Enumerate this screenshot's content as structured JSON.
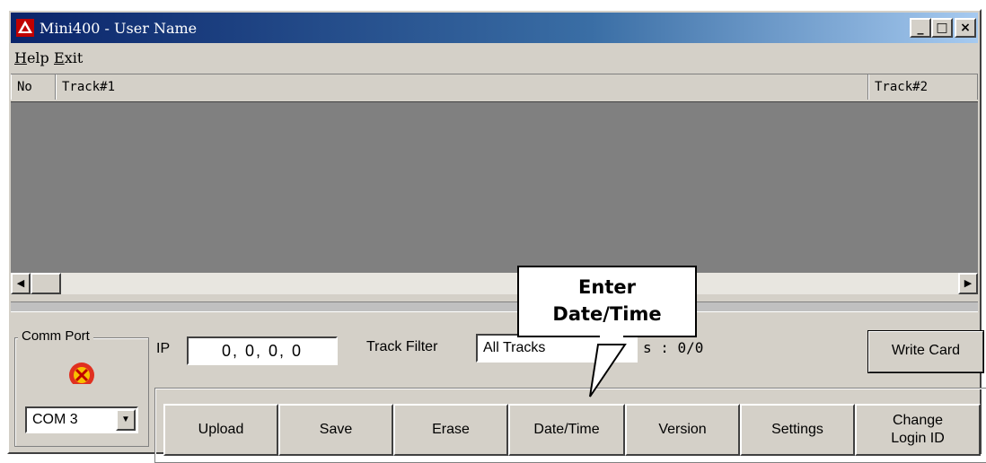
{
  "window": {
    "title": "Mini400  -  User Name",
    "controls": {
      "minimize": "_",
      "maximize": "□",
      "close": "×"
    }
  },
  "menu": [
    {
      "label": "elp",
      "mnemonic": "H"
    },
    {
      "label": "xit",
      "mnemonic": "E"
    }
  ],
  "grid": {
    "columns": [
      "No",
      "Track#1",
      "Track#2"
    ]
  },
  "comm_port": {
    "legend": "Comm Port",
    "icon": "modem-icon",
    "value": "COM 3"
  },
  "ip": {
    "label": "IP",
    "value": "0,  0,  0,  0"
  },
  "track_filter": {
    "label": "Track Filter",
    "value": "All Tracks"
  },
  "records_text": "s : 0/0",
  "write_card_label": "Write Card",
  "actions": {
    "upload": "Upload",
    "save": "Save",
    "erase": "Erase",
    "datetime": "Date/Time",
    "version": "Version",
    "settings": "Settings",
    "change_login_line1": "Change",
    "change_login_line2": "Login ID"
  },
  "callout": {
    "line1": "Enter",
    "line2": "Date/Time"
  },
  "colors": {
    "titlebar_start": "#0a246a",
    "titlebar_end": "#a6caf0",
    "window_face": "#d4d0c8",
    "grid_body": "#808080"
  }
}
